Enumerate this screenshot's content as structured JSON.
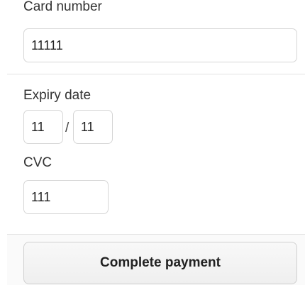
{
  "card": {
    "label": "Card number",
    "value": "11111"
  },
  "expiry": {
    "label": "Expiry date",
    "month": "11",
    "separator": "/",
    "year": "11"
  },
  "cvc": {
    "label": "CVC",
    "value": "111"
  },
  "actions": {
    "submit_label": "Complete payment"
  }
}
